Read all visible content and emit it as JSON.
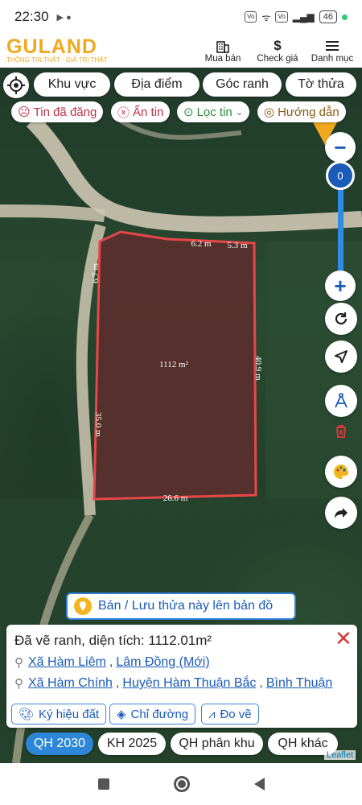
{
  "status": {
    "time": "22:30",
    "battery": "46"
  },
  "header": {
    "logo": "GULAND",
    "slogan": "THÔNG TIN THẬT · GIÁ TRỊ THẬT",
    "nav": [
      {
        "label": "Mua bán",
        "icon": "building-icon"
      },
      {
        "label": "Check giá",
        "icon": "dollar-icon"
      },
      {
        "label": "Danh mục",
        "icon": "menu-icon"
      }
    ]
  },
  "filters": {
    "pills": [
      "Khu vực",
      "Địa điểm",
      "Góc ranh",
      "Tờ thửa"
    ],
    "chips": [
      {
        "label": "Tin đã đăng",
        "icon": "sad-face-icon"
      },
      {
        "label": "Ẩn tin",
        "icon": "close-circle-icon"
      },
      {
        "label": "Lọc tin",
        "icon": "location-pin-icon"
      },
      {
        "label": "Hướng dẫn",
        "icon": "target-icon"
      }
    ]
  },
  "map": {
    "zoom_level": "0",
    "area_label": "1112 m²",
    "measurements": [
      "6.2 m",
      "5.3 m",
      "6.7 m",
      "35.0 m",
      "40.9 m",
      "26.6 m"
    ],
    "attribution": "Leaflet",
    "colors": {
      "polygon_stroke": "#e8474a",
      "polygon_fill": "#5a2f2c",
      "road": "#cfc7b2"
    }
  },
  "banner": {
    "label": "Bán / Lưu thửa này lên bản đồ"
  },
  "panel": {
    "title": "Đã vẽ ranh, diện tích: 1112.01m²",
    "location_new": {
      "commune": "Xã Hàm Liêm",
      "province": "Lâm Đồng (Mới)"
    },
    "location_old": {
      "commune": "Xã Hàm Chính",
      "district": "Huyện Hàm Thuận Bắc",
      "province": "Bình Thuận"
    },
    "buttons": [
      "Ký hiệu đất",
      "Chỉ đường",
      "Đo vẽ"
    ]
  },
  "tabs": [
    "QH 2030",
    "KH 2025",
    "QH phân khu",
    "QH khác"
  ],
  "active_tab": "QH 2030"
}
